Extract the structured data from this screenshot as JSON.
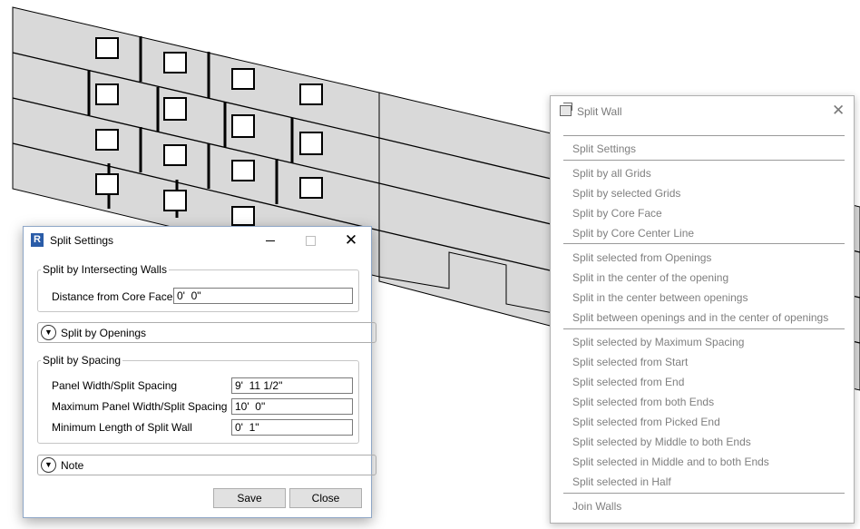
{
  "split_settings": {
    "title": "Split Settings",
    "app_icon": "R",
    "intersecting_walls": {
      "legend": "Split by Intersecting Walls",
      "core_face_label": "Distance from Core Face",
      "core_face_value": "0'  0\""
    },
    "openings_label": "Split by Openings",
    "spacing": {
      "legend": "Split by Spacing",
      "panel_width_label": "Panel Width/Split Spacing",
      "panel_width_value": "9'  11 1/2\"",
      "max_width_label": "Maximum Panel Width/Split Spacing",
      "max_width_value": "10'  0\"",
      "min_length_label": "Minimum Length of Split Wall",
      "min_length_value": "0'  1\""
    },
    "note_label": "Note",
    "save_label": "Save",
    "close_label": "Close"
  },
  "split_wall_panel": {
    "title": "Split Wall",
    "settings_item": "Split Settings",
    "grid_items": [
      "Split by all Grids",
      "Split by selected Grids",
      "Split by Core Face",
      "Split by Core Center Line"
    ],
    "opening_items": [
      "Split selected from Openings",
      "Split in the center of the opening",
      "Split in the center between openings",
      "Split between openings and in the center of openings"
    ],
    "spacing_items": [
      "Split selected by Maximum Spacing",
      "Split selected from Start",
      "Split selected from End",
      "Split selected from both Ends",
      "Split selected from Picked End",
      "Split selected by Middle to both Ends",
      "Split selected in Middle and to both Ends",
      "Split selected in Half"
    ],
    "join_item": "Join Walls"
  },
  "icons": [
    "revit-app-icon",
    "split-wall-icon",
    "close-icon",
    "minimize-icon",
    "maximize-icon",
    "chevron-down-icon"
  ],
  "colors": {
    "wall_fill": "#d9d9d9",
    "wall_edge": "#000000",
    "panel_text": "#7f7f7f",
    "dialog_border": "#8fa7c7"
  }
}
